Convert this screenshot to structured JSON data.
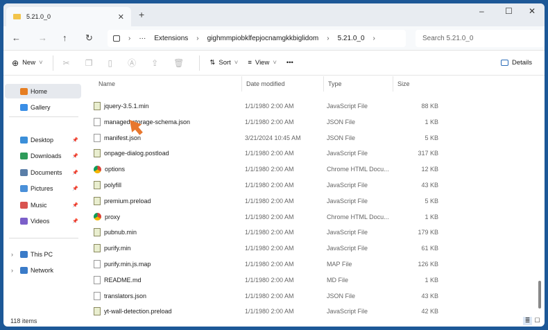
{
  "window": {
    "tab_title": "5.21.0_0",
    "close_tab": "✕",
    "new_tab": "+",
    "minimize": "–",
    "maximize": "☐",
    "close": "✕"
  },
  "address": {
    "back": "←",
    "forward": "→",
    "up": "↑",
    "refresh": "↻",
    "crumbs": [
      "Extensions",
      "gighmmpiobklfepjocnamgkkbiglidom",
      "5.21.0_0"
    ],
    "search_placeholder": "Search 5.21.0_0"
  },
  "toolbar": {
    "new": "New",
    "sort": "Sort",
    "view": "View",
    "more": "•••",
    "details": "Details"
  },
  "sidebar": {
    "items": [
      {
        "label": "Home",
        "icon": "home-icon",
        "color": "#e67e22"
      },
      {
        "label": "Gallery",
        "icon": "gallery-icon",
        "color": "#3a8ee6"
      },
      {
        "label": "Desktop",
        "icon": "desktop-icon",
        "color": "#3b8fd9"
      },
      {
        "label": "Downloads",
        "icon": "download-icon",
        "color": "#2e9b5a"
      },
      {
        "label": "Documents",
        "icon": "documents-icon",
        "color": "#5a7ea8"
      },
      {
        "label": "Pictures",
        "icon": "pictures-icon",
        "color": "#4a90d9"
      },
      {
        "label": "Music",
        "icon": "music-icon",
        "color": "#d9534f"
      },
      {
        "label": "Videos",
        "icon": "videos-icon",
        "color": "#7b5fc9"
      },
      {
        "label": "This PC",
        "icon": "pc-icon",
        "color": "#3a7bc8"
      },
      {
        "label": "Network",
        "icon": "network-icon",
        "color": "#3a7bc8"
      }
    ]
  },
  "columns": {
    "name": "Name",
    "date": "Date modified",
    "type": "Type",
    "size": "Size"
  },
  "files": [
    {
      "name": "jquery-3.5.1.min",
      "date": "1/1/1980 2:00 AM",
      "type": "JavaScript File",
      "size": "88 KB",
      "icon": "js"
    },
    {
      "name": "managed-storage-schema.json",
      "date": "1/1/1980 2:00 AM",
      "type": "JSON File",
      "size": "1 KB",
      "icon": "file"
    },
    {
      "name": "manifest.json",
      "date": "3/21/2024 10:45 AM",
      "type": "JSON File",
      "size": "5 KB",
      "icon": "file"
    },
    {
      "name": "onpage-dialog.postload",
      "date": "1/1/1980 2:00 AM",
      "type": "JavaScript File",
      "size": "317 KB",
      "icon": "js"
    },
    {
      "name": "options",
      "date": "1/1/1980 2:00 AM",
      "type": "Chrome HTML Docu...",
      "size": "12 KB",
      "icon": "chrome"
    },
    {
      "name": "polyfill",
      "date": "1/1/1980 2:00 AM",
      "type": "JavaScript File",
      "size": "43 KB",
      "icon": "js"
    },
    {
      "name": "premium.preload",
      "date": "1/1/1980 2:00 AM",
      "type": "JavaScript File",
      "size": "5 KB",
      "icon": "js"
    },
    {
      "name": "proxy",
      "date": "1/1/1980 2:00 AM",
      "type": "Chrome HTML Docu...",
      "size": "1 KB",
      "icon": "chrome"
    },
    {
      "name": "pubnub.min",
      "date": "1/1/1980 2:00 AM",
      "type": "JavaScript File",
      "size": "179 KB",
      "icon": "js"
    },
    {
      "name": "purify.min",
      "date": "1/1/1980 2:00 AM",
      "type": "JavaScript File",
      "size": "61 KB",
      "icon": "js"
    },
    {
      "name": "purify.min.js.map",
      "date": "1/1/1980 2:00 AM",
      "type": "MAP File",
      "size": "126 KB",
      "icon": "file"
    },
    {
      "name": "README.md",
      "date": "1/1/1980 2:00 AM",
      "type": "MD File",
      "size": "1 KB",
      "icon": "file"
    },
    {
      "name": "translators.json",
      "date": "1/1/1980 2:00 AM",
      "type": "JSON File",
      "size": "43 KB",
      "icon": "file"
    },
    {
      "name": "yt-wall-detection.preload",
      "date": "1/1/1980 2:00 AM",
      "type": "JavaScript File",
      "size": "42 KB",
      "icon": "js"
    }
  ],
  "status": {
    "count": "118 items"
  }
}
